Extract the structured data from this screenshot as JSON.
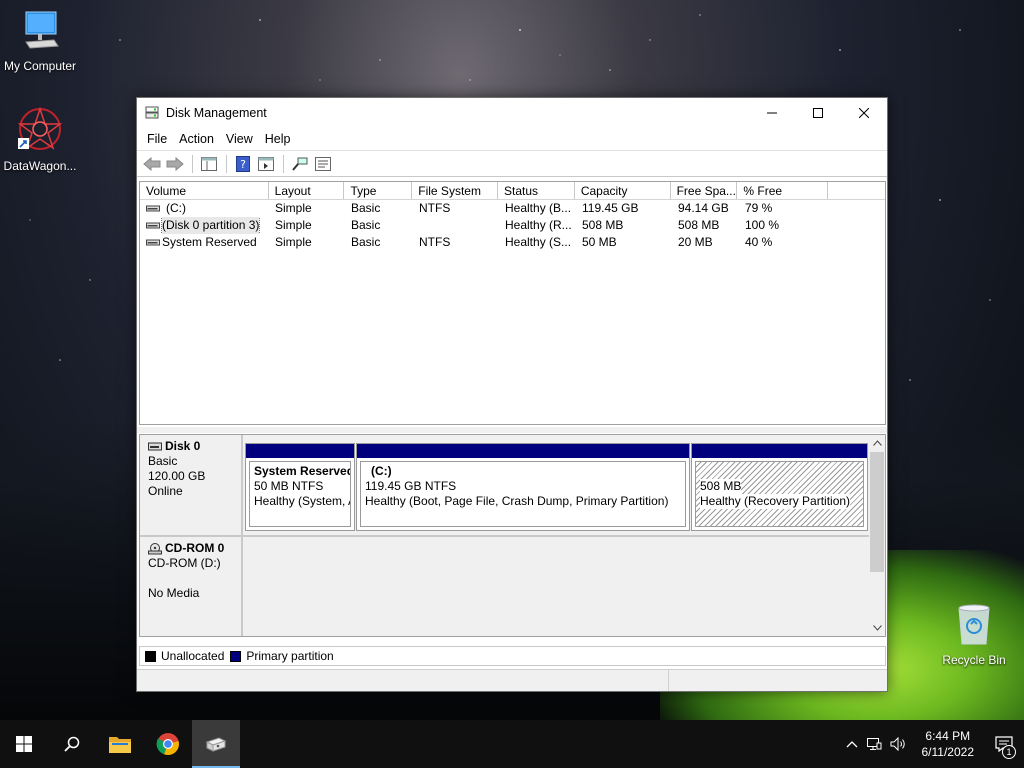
{
  "desktop": {
    "icons": [
      {
        "label": "My Computer",
        "icon": "computer-icon"
      },
      {
        "label": "DataWagon...",
        "icon": "datawagon-shortcut-icon"
      },
      {
        "label": "Recycle Bin",
        "icon": "recycle-bin-icon"
      }
    ]
  },
  "window": {
    "title": "Disk Management",
    "menu": [
      "File",
      "Action",
      "View",
      "Help"
    ],
    "toolbar_icons": [
      "back-arrow-icon",
      "forward-arrow-icon",
      "show-hide-console-tree-icon",
      "help-icon",
      "export-icon",
      "connect-icon",
      "properties-icon"
    ],
    "volume_columns": [
      "Volume",
      "Layout",
      "Type",
      "File System",
      "Status",
      "Capacity",
      "Free Spa...",
      "% Free"
    ],
    "volumes": [
      {
        "volume": "(C:)",
        "layout": "Simple",
        "type": "Basic",
        "fs": "NTFS",
        "status": "Healthy (B...",
        "capacity": "119.45 GB",
        "free": "94.14 GB",
        "pct": "79 %"
      },
      {
        "volume": "(Disk 0 partition 3)",
        "layout": "Simple",
        "type": "Basic",
        "fs": "",
        "status": "Healthy (R...",
        "capacity": "508 MB",
        "free": "508 MB",
        "pct": "100 %"
      },
      {
        "volume": "System Reserved",
        "layout": "Simple",
        "type": "Basic",
        "fs": "NTFS",
        "status": "Healthy (S...",
        "capacity": "50 MB",
        "free": "20 MB",
        "pct": "40 %"
      }
    ],
    "disks": [
      {
        "name": "Disk 0",
        "type": "Basic",
        "size": "120.00 GB",
        "state": "Online",
        "partitions": [
          {
            "title": "System Reserved",
            "size": "50 MB NTFS",
            "status": "Healthy (System, A"
          },
          {
            "title": "(C:)",
            "size": "119.45 GB NTFS",
            "status": "Healthy (Boot, Page File, Crash Dump, Primary Partition)"
          },
          {
            "title": "",
            "size": "508 MB",
            "status": "Healthy (Recovery Partition)"
          }
        ]
      },
      {
        "name": "CD-ROM 0",
        "type": "CD-ROM (D:)",
        "size": "",
        "state": "No Media"
      }
    ],
    "legend": [
      {
        "label": "Unallocated",
        "color": "#000000"
      },
      {
        "label": "Primary partition",
        "color": "#00007f"
      }
    ]
  },
  "taskbar": {
    "apps": [
      "start-icon",
      "search-icon",
      "file-explorer-icon",
      "chrome-icon",
      "disk-management-icon"
    ],
    "time": "6:44 PM",
    "date": "6/11/2022",
    "notification_count": "1"
  }
}
